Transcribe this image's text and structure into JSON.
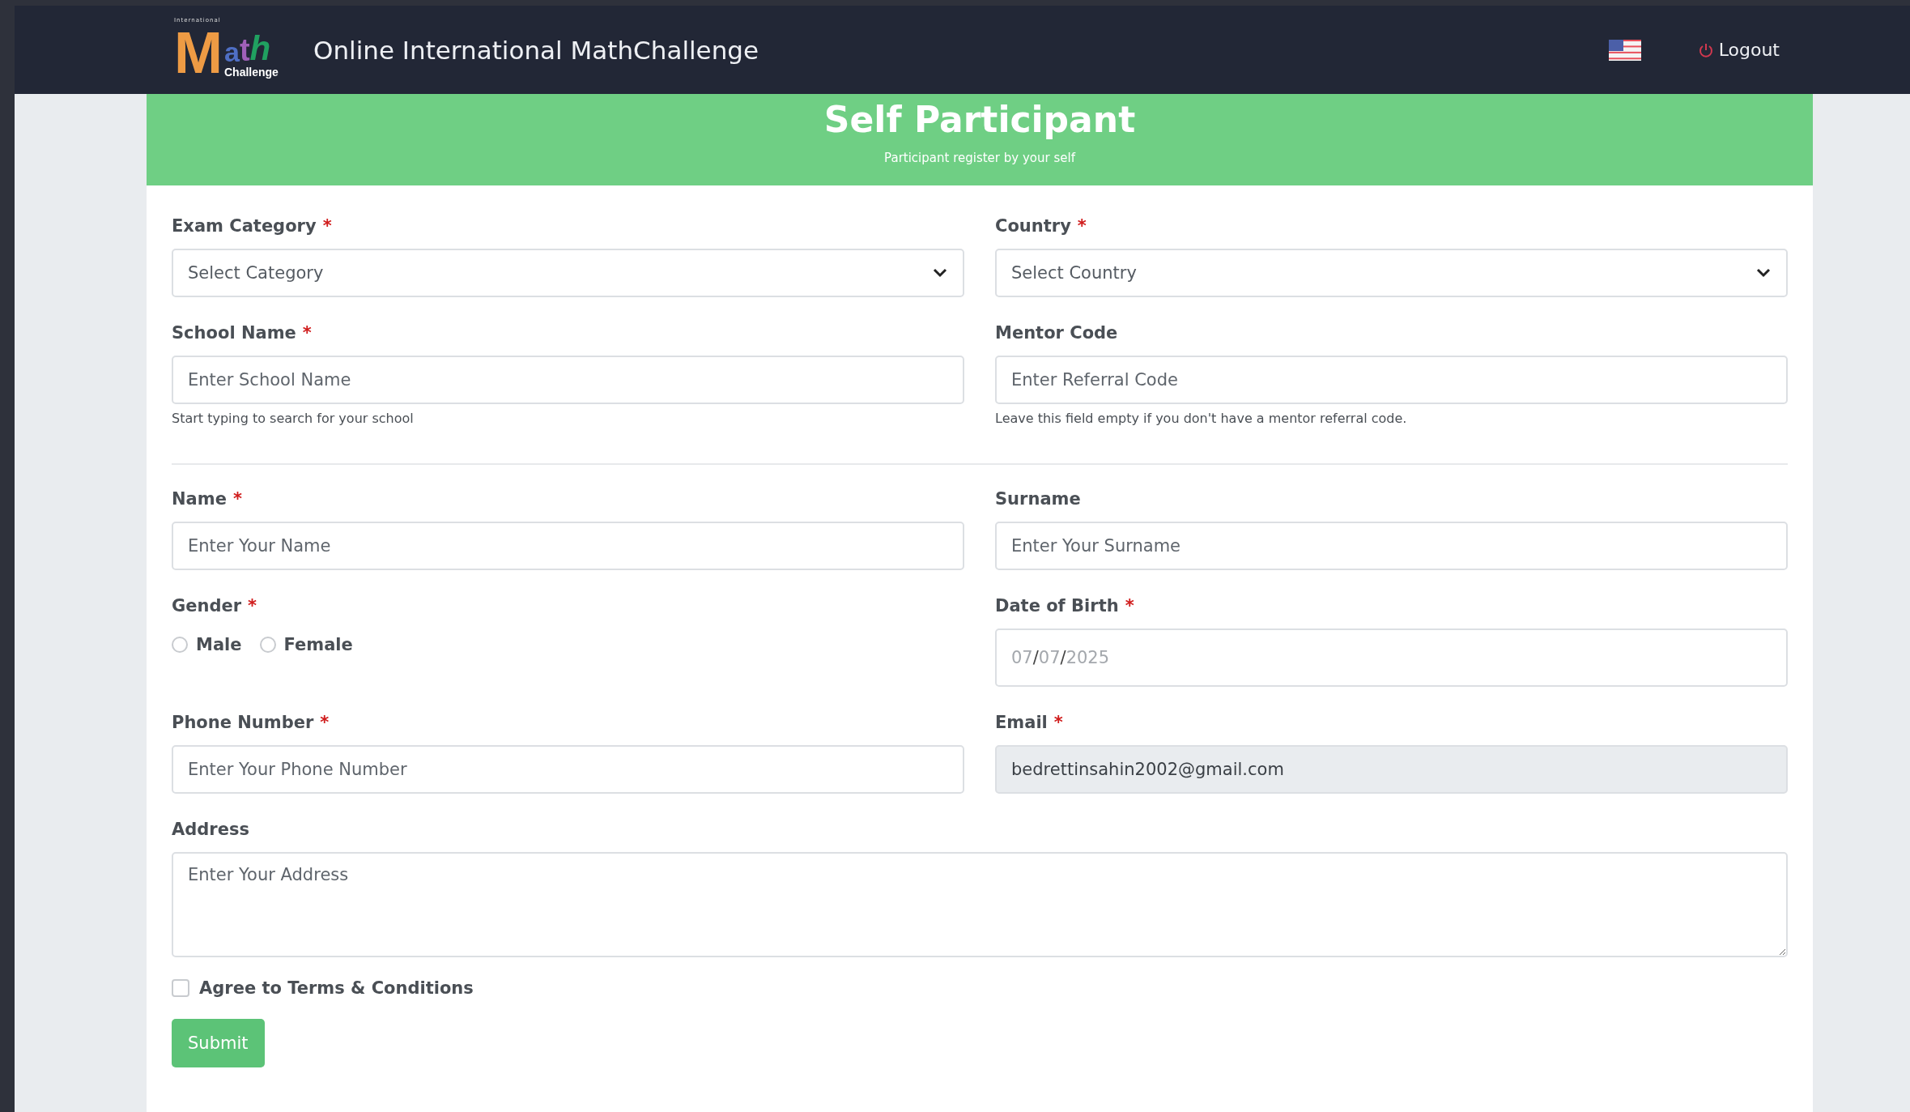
{
  "header": {
    "logo": {
      "top": "International",
      "letters": [
        "M",
        "a",
        "t",
        "h"
      ],
      "bottom": "Challenge"
    },
    "title": "Online International MathChallenge",
    "logout": "Logout"
  },
  "banner": {
    "title": "Self Participant",
    "subtitle": "Participant register by your self"
  },
  "sections": [
    {
      "fields": [
        {
          "kind": "select",
          "label": "Exam Category",
          "marker": "*",
          "placeholder": "Select Category"
        },
        {
          "kind": "select",
          "label": "Country",
          "marker": "*",
          "placeholder": "Select Country"
        },
        {
          "kind": "text",
          "label": "School Name",
          "marker": "*",
          "placeholder": "Enter School Name",
          "help": "Start typing to search for your school"
        },
        {
          "kind": "text",
          "label": "Mentor Code",
          "placeholder": "Enter Referral Code",
          "help": "Leave this field empty if you don't have a mentor referral code."
        }
      ]
    },
    {
      "fields": [
        {
          "kind": "text",
          "label": "Name",
          "marker": "*",
          "placeholder": "Enter Your Name"
        },
        {
          "kind": "text",
          "label": "Surname",
          "placeholder": "Enter Your Surname"
        },
        {
          "kind": "radio",
          "label": "Gender",
          "marker": "*",
          "options": [
            {
              "label": "Male",
              "selected": false
            },
            {
              "label": "Female",
              "selected": false
            }
          ]
        },
        {
          "kind": "date",
          "label": "Date of Birth",
          "marker": "*",
          "parts": [
            "07",
            "07",
            "2025"
          ],
          "separator": "/"
        },
        {
          "kind": "text",
          "label": "Phone Number",
          "marker": "*",
          "placeholder": "Enter Your Phone Number"
        },
        {
          "kind": "text",
          "label": "Email",
          "marker": "*",
          "value": "bedrettinsahin2002@gmail.com",
          "disabled": true
        },
        {
          "kind": "textarea",
          "label": "Address",
          "placeholder": "Enter Your Address"
        }
      ]
    }
  ],
  "agree": {
    "label": "Agree to Terms & Conditions",
    "checked": false
  },
  "submit": "Submit"
}
